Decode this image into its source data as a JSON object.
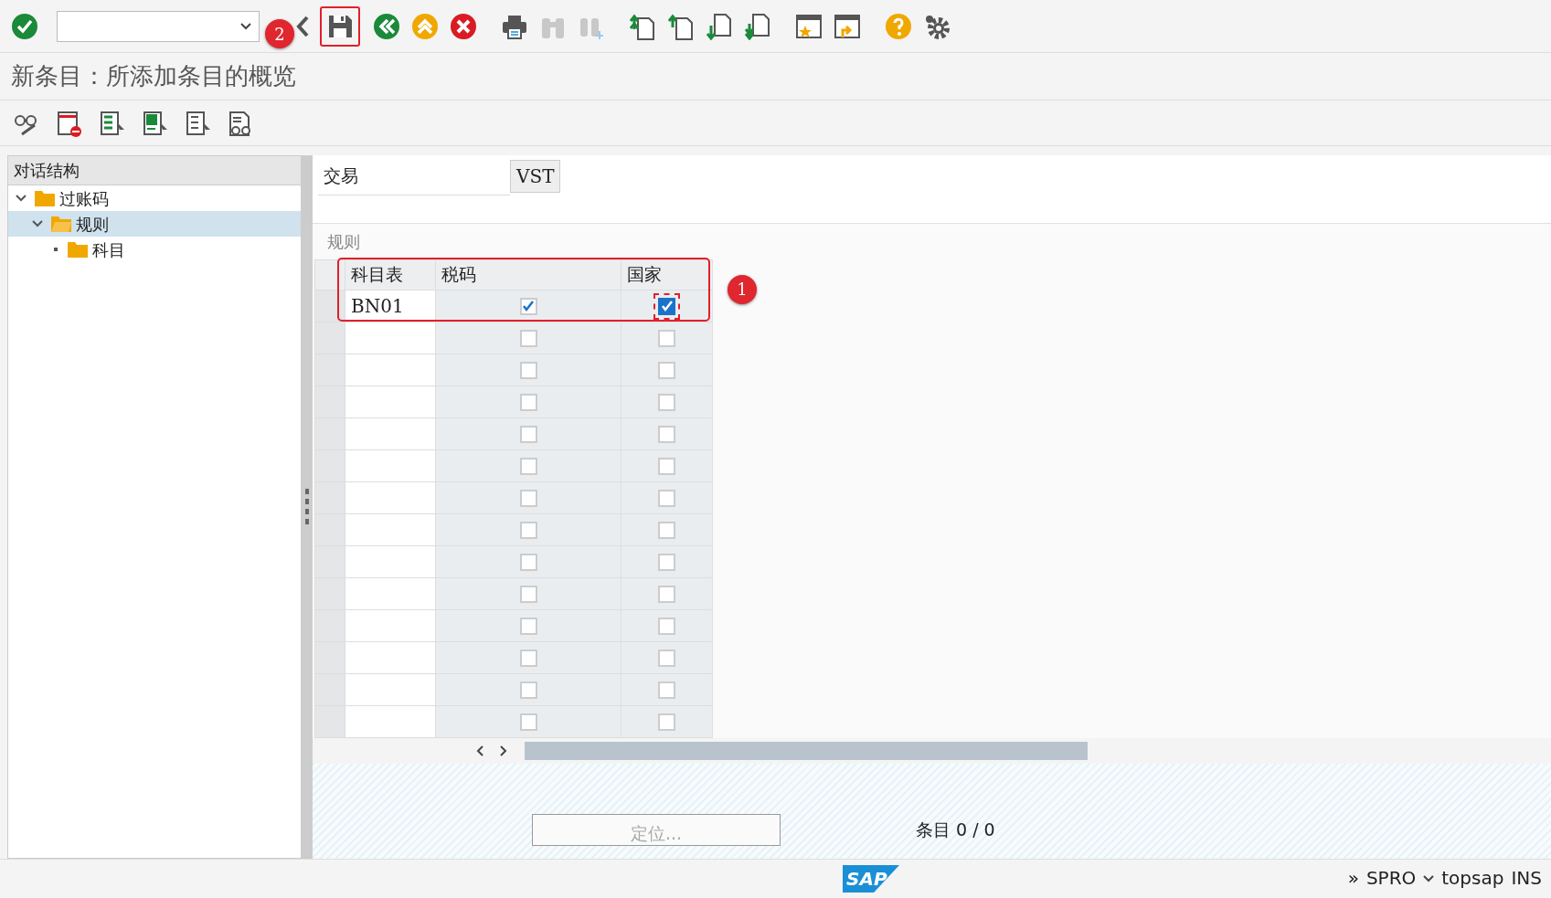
{
  "toolbar": {
    "annotation": "2"
  },
  "title": "新条目：所添加条目的概览",
  "tree": {
    "title": "对话结构",
    "items": [
      {
        "label": "过账码",
        "expanded": true,
        "selected": false,
        "children": [
          {
            "label": "规则",
            "expanded": true,
            "selected": true,
            "children": [
              {
                "label": "科目",
                "selected": false
              }
            ]
          }
        ]
      }
    ]
  },
  "field": {
    "label": "交易",
    "value": "VST"
  },
  "table": {
    "title": "规则",
    "annotation": "1",
    "columns": [
      "科目表",
      "税码",
      "国家"
    ],
    "rows": [
      {
        "chart_of_accounts": "BN01",
        "tax_code": true,
        "country": true
      },
      {
        "tax_code": false,
        "country": false
      },
      {
        "tax_code": false,
        "country": false
      },
      {
        "tax_code": false,
        "country": false
      },
      {
        "tax_code": false,
        "country": false
      },
      {
        "tax_code": false,
        "country": false
      },
      {
        "tax_code": false,
        "country": false
      },
      {
        "tax_code": false,
        "country": false
      },
      {
        "tax_code": false,
        "country": false
      },
      {
        "tax_code": false,
        "country": false
      },
      {
        "tax_code": false,
        "country": false
      },
      {
        "tax_code": false,
        "country": false
      },
      {
        "tax_code": false,
        "country": false
      },
      {
        "tax_code": false,
        "country": false
      }
    ]
  },
  "footer": {
    "position_button": "定位...",
    "entries": "条目 0 / 0"
  },
  "status_bar": {
    "more": "»",
    "logo": "SAP",
    "transaction": "SPRO",
    "server": "topsap",
    "mode": "INS"
  }
}
